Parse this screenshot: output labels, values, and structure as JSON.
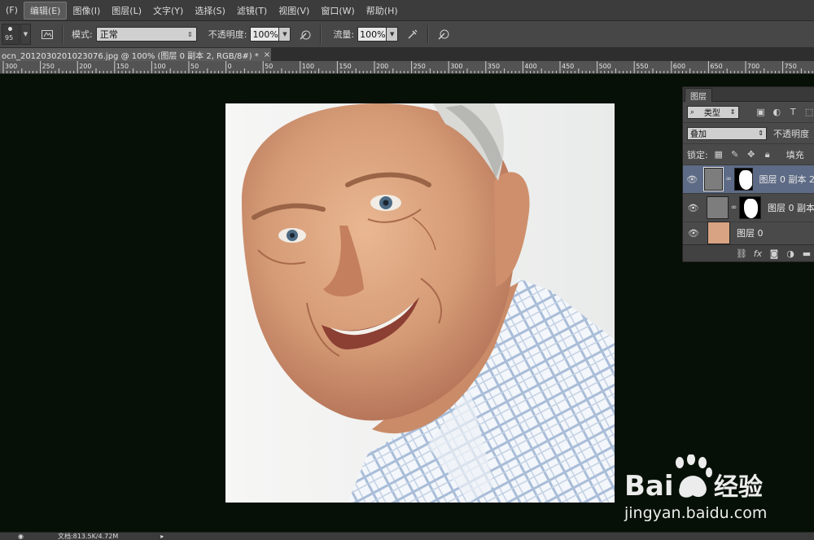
{
  "menubar": {
    "items": [
      "(F)",
      "编辑(E)",
      "图像(I)",
      "图层(L)",
      "文字(Y)",
      "选择(S)",
      "滤镜(T)",
      "视图(V)",
      "窗口(W)",
      "帮助(H)"
    ],
    "active_index": 1
  },
  "options": {
    "brush_size": "95",
    "mode_label": "模式:",
    "mode_value": "正常",
    "opacity_label": "不透明度:",
    "opacity_value": "100%",
    "flow_label": "流量:",
    "flow_value": "100%"
  },
  "document": {
    "tab_title": "ocn_20120302010230​76.jpg @ 100% (图层 0 副本 2, RGB/8#) *",
    "tab_close": "×"
  },
  "ruler": {
    "labels": [
      "300",
      "250",
      "200",
      "150",
      "100",
      "50",
      "0",
      "50",
      "100",
      "150",
      "200",
      "250",
      "300",
      "350",
      "400",
      "450",
      "500",
      "550",
      "600",
      "650",
      "700",
      "750"
    ]
  },
  "layers_panel": {
    "tab": "图层",
    "filter_value": "类型",
    "blend_mode": "叠加",
    "opacity_label": "不透明度",
    "lock_label": "锁定:",
    "fill_label": "填充",
    "layers": [
      {
        "name": "图层 0 副本 2",
        "has_mask": true,
        "selected": true
      },
      {
        "name": "图层 0 副本",
        "has_mask": true,
        "selected": false
      },
      {
        "name": "图层 0",
        "has_mask": false,
        "selected": false
      }
    ]
  },
  "statusbar": {
    "text": "文档:813.5K/4.72M"
  },
  "watermark": {
    "brand": "Bai",
    "brand_suffix": "经验",
    "url": "jingyan.baidu.com"
  }
}
